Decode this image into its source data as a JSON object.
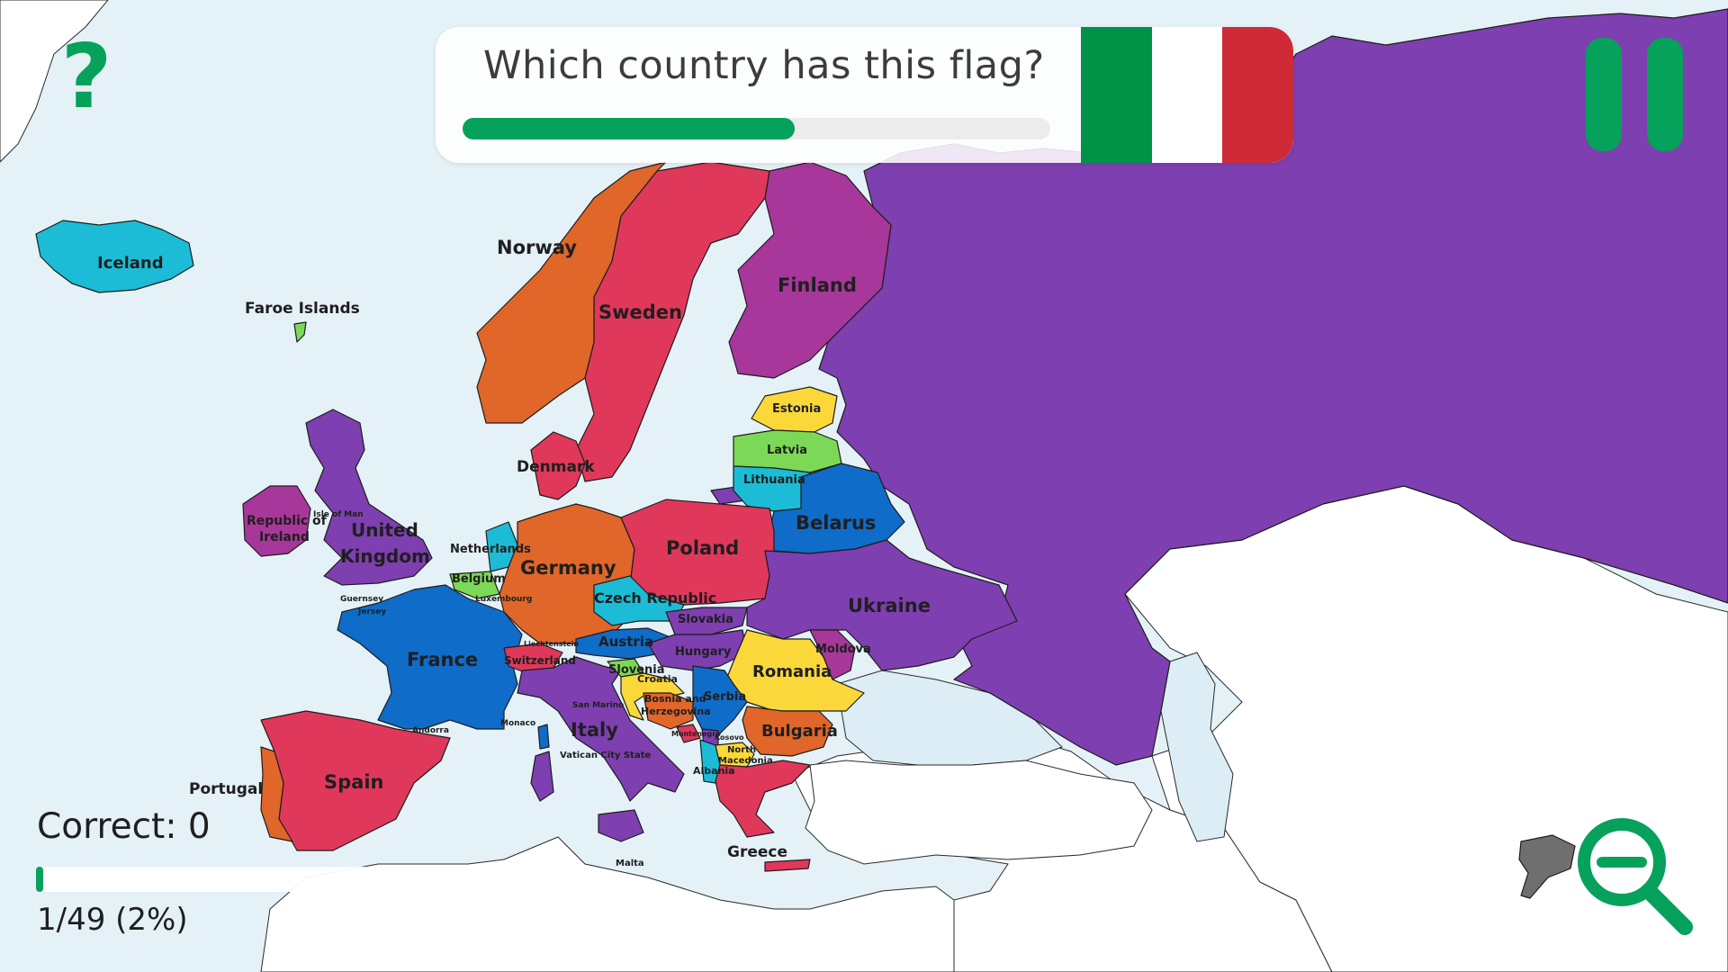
{
  "question": {
    "prompt": "Which country has this flag?",
    "timer_fraction": 0.565,
    "flag": {
      "country_hint": "Italy",
      "stripes": [
        "#009246",
        "#ffffff",
        "#ce2b37"
      ]
    }
  },
  "controls": {
    "help_glyph": "?",
    "pause_icon": "pause-icon",
    "zoom_icon": "zoom-out-icon",
    "accent_color": "#06a15a"
  },
  "score": {
    "correct_label": "Correct: 0",
    "progress_text": "1/49 (2%)",
    "progress_fraction": 0.02
  },
  "map": {
    "labels": {
      "iceland": "Iceland",
      "faroe": "Faroe Islands",
      "norway": "Norway",
      "sweden": "Sweden",
      "finland": "Finland",
      "estonia": "Estonia",
      "latvia": "Latvia",
      "lithuania": "Lithuania",
      "belarus": "Belarus",
      "denmark": "Denmark",
      "ireland_1": "Republic of",
      "ireland_2": "Ireland",
      "isle_of_man": "Isle of Man",
      "uk_1": "United",
      "uk_2": "Kingdom",
      "netherlands": "Netherlands",
      "belgium": "Belgium",
      "luxembourg": "Luxembourg",
      "germany": "Germany",
      "poland": "Poland",
      "czech": "Czech Republic",
      "slovakia": "Slovakia",
      "ukraine": "Ukraine",
      "moldova": "Moldova",
      "austria": "Austria",
      "hungary": "Hungary",
      "romania": "Romania",
      "guernsey": "Guernsey",
      "jersey": "Jersey",
      "france": "France",
      "liechtenstein": "Liechtenstein",
      "switzerland": "Switzerland",
      "slovenia": "Slovenia",
      "croatia": "Croatia",
      "bosnia_1": "Bosnia and",
      "bosnia_2": "Herzegovina",
      "serbia": "Serbia",
      "montenegro": "Montenegro",
      "kosovo": "Kosovo",
      "bulgaria": "Bulgaria",
      "north_mac_1": "North",
      "north_mac_2": "Macedonia",
      "albania": "Albania",
      "san_marino": "San Marino",
      "monaco": "Monaco",
      "andorra": "Andorra",
      "italy": "Italy",
      "vatican": "Vatican City State",
      "spain": "Spain",
      "portugal": "Portugal",
      "greece": "Greece",
      "malta": "Malta"
    },
    "colors": {
      "purple": "#7e3fb0",
      "magenta": "#a7379a",
      "red": "#e0385a",
      "orange": "#e0662a",
      "blue": "#0f6cc8",
      "cyan": "#1cbcd6",
      "yellow": "#fbd83a",
      "green": "#7cd957",
      "grey": "#6f6f6f"
    }
  }
}
